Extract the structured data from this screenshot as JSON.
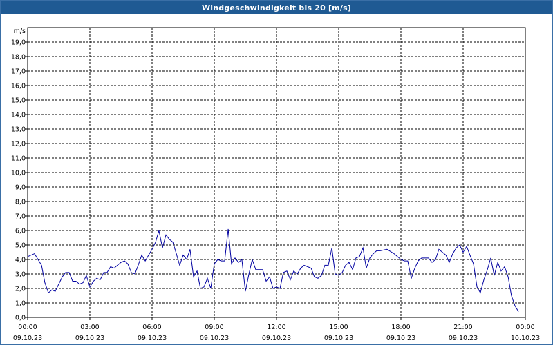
{
  "window": {
    "title": "Windgeschwindigkeit bis 20 [m/s]"
  },
  "colors": {
    "title_bar": "#1f5a93",
    "series": "#0000a0",
    "grid": "#000000",
    "background": "#ffffff"
  },
  "chart_data": {
    "type": "line",
    "title": "Windgeschwindigkeit bis 20 [m/s]",
    "ylabel": "m/s",
    "xlabel": "",
    "ylim": [
      0,
      20
    ],
    "xlim": [
      "09.10.23 00:00",
      "10.10.23 00:00"
    ],
    "grid": true,
    "y_ticks": [
      "0,0",
      "1,0",
      "2,0",
      "3,0",
      "4,0",
      "5,0",
      "6,0",
      "7,0",
      "8,0",
      "9,0",
      "10,0",
      "11,0",
      "12,0",
      "13,0",
      "14,0",
      "15,0",
      "16,0",
      "17,0",
      "18,0",
      "19,0"
    ],
    "x_ticks": [
      {
        "time": "00:00",
        "date": "09.10.23"
      },
      {
        "time": "03:00",
        "date": "09.10.23"
      },
      {
        "time": "06:00",
        "date": "09.10.23"
      },
      {
        "time": "09:00",
        "date": "09.10.23"
      },
      {
        "time": "12:00",
        "date": "09.10.23"
      },
      {
        "time": "15:00",
        "date": "09.10.23"
      },
      {
        "time": "18:00",
        "date": "09.10.23"
      },
      {
        "time": "21:00",
        "date": "09.10.23"
      },
      {
        "time": "00:00",
        "date": "10.10.23"
      }
    ],
    "series": [
      {
        "x_hours": [
          0,
          0.33,
          0.67,
          0.83,
          1.0,
          1.17,
          1.33,
          1.5,
          1.67,
          1.83,
          2.0,
          2.17,
          2.33,
          2.5,
          2.67,
          2.83,
          3.0,
          3.17,
          3.33,
          3.5,
          3.67,
          3.83,
          4.0,
          4.17,
          4.33,
          4.5,
          4.67,
          4.83,
          5.0,
          5.17,
          5.33,
          5.5,
          5.67,
          5.83,
          6.0,
          6.17,
          6.33,
          6.5,
          6.67,
          6.83,
          7.0,
          7.17,
          7.33,
          7.5,
          7.67,
          7.83,
          8.0,
          8.17,
          8.33,
          8.5,
          8.67,
          8.83,
          9.0,
          9.17,
          9.33,
          9.5,
          9.67,
          9.83,
          10.0,
          10.17,
          10.33,
          10.5,
          10.67,
          10.83,
          11.0,
          11.17,
          11.33,
          11.5,
          11.67,
          11.83,
          12.0,
          12.17,
          12.33,
          12.5,
          12.67,
          12.83,
          13.0,
          13.17,
          13.33,
          13.5,
          13.67,
          13.83,
          14.0,
          14.17,
          14.33,
          14.5,
          14.67,
          14.83,
          15.0,
          15.17,
          15.33,
          15.5,
          15.67,
          15.83,
          16.0,
          16.17,
          16.33,
          16.5,
          16.67,
          16.83,
          17.0,
          17.33,
          17.67,
          18.0,
          18.17,
          18.33,
          18.5,
          18.67,
          18.83,
          19.0,
          19.17,
          19.33,
          19.5,
          19.67,
          19.83,
          20.0,
          20.17,
          20.33,
          20.5,
          20.67,
          20.83,
          21.0,
          21.17,
          21.33,
          21.5,
          21.67,
          21.83,
          22.0,
          22.17,
          22.33,
          22.5,
          22.67,
          22.83,
          23.0,
          23.17,
          23.33,
          23.5,
          23.67,
          23.83,
          24.0
        ],
        "values": [
          4.2,
          4.4,
          3.6,
          2.4,
          1.7,
          1.9,
          1.8,
          2.3,
          2.8,
          3.1,
          3.1,
          2.5,
          2.5,
          2.3,
          2.4,
          2.9,
          2.1,
          2.5,
          2.7,
          2.6,
          3.1,
          3.1,
          3.5,
          3.4,
          3.6,
          3.8,
          3.9,
          3.7,
          3.1,
          3.0,
          3.6,
          4.3,
          3.9,
          4.3,
          4.7,
          5.2,
          6.0,
          4.8,
          5.7,
          5.4,
          5.2,
          4.4,
          3.6,
          4.3,
          4.0,
          4.7,
          2.8,
          3.2,
          2.0,
          2.1,
          2.7,
          2.0,
          3.7,
          4.0,
          3.9,
          3.9,
          6.1,
          3.7,
          4.1,
          3.8,
          4.0,
          1.8,
          3.0,
          4.0,
          3.3,
          3.3,
          3.3,
          2.5,
          2.8,
          2.0,
          2.1,
          2.0,
          3.1,
          3.2,
          2.6,
          3.2,
          3.0,
          3.4,
          3.6,
          3.5,
          3.4,
          2.8,
          2.7,
          2.9,
          3.6,
          3.6,
          4.8,
          3.0,
          2.9,
          3.1,
          3.6,
          3.8,
          3.3,
          4.1,
          4.2,
          4.8,
          3.4,
          4.1,
          4.4,
          4.6,
          4.6,
          4.7,
          4.4,
          4.0,
          3.9,
          3.9,
          2.7,
          3.4,
          3.9,
          4.1,
          4.1,
          4.1,
          3.8,
          4.0,
          4.7,
          4.5,
          4.3,
          3.8,
          4.4,
          4.8,
          5.0,
          4.5,
          4.9,
          4.3,
          3.7,
          2.1,
          1.7,
          2.6,
          3.3,
          4.1,
          2.9,
          3.8,
          3.2,
          3.5,
          2.8,
          1.5,
          0.8,
          0.4
        ]
      }
    ]
  }
}
